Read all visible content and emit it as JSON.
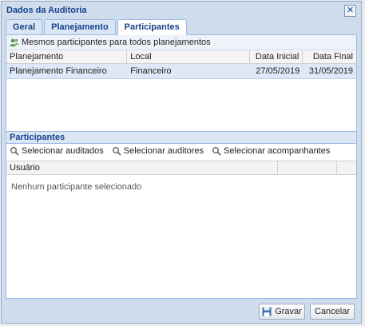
{
  "window": {
    "title": "Dados da Auditoria"
  },
  "tabs": [
    {
      "label": "Geral"
    },
    {
      "label": "Planejamento"
    },
    {
      "label": "Participantes"
    }
  ],
  "toolbar": {
    "same_participants": "Mesmos participantes para todos planejamentos"
  },
  "plan_grid": {
    "columns": [
      "Planejamento",
      "Local",
      "Data Inicial",
      "Data Final"
    ],
    "rows": [
      {
        "planejamento": "Planejamento Financeiro",
        "local": "Financeiro",
        "data_inicial": "27/05/2019",
        "data_final": "31/05/2019"
      }
    ]
  },
  "participants": {
    "title": "Participantes",
    "select_audited": "Selecionar auditados",
    "select_auditors": "Selecionar auditores",
    "select_companions": "Selecionar acompanhantes",
    "column_user": "Usuário",
    "empty": "Nenhum participante selecionado"
  },
  "footer": {
    "save": "Gravar",
    "cancel": "Cancelar"
  },
  "colors": {
    "accent": "#15428b",
    "border": "#99bbe8",
    "selected_row": "#dfe8f6"
  }
}
